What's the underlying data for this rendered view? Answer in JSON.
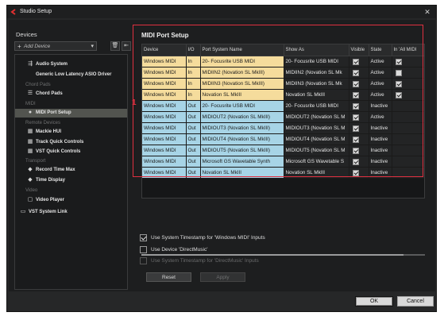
{
  "window": {
    "title": "Studio Setup",
    "close_glyph": "✕"
  },
  "left": {
    "devices_label": "Devices",
    "add_device_placeholder": "Add Device",
    "tree": [
      {
        "kind": "item",
        "label": "Audio System",
        "icon": "connector-icon",
        "glyph": "⇶",
        "indent": 1
      },
      {
        "kind": "item",
        "label": "Generic Low Latency ASIO Driver",
        "icon": "",
        "glyph": "",
        "indent": 2
      },
      {
        "kind": "category",
        "label": "Chord Pads"
      },
      {
        "kind": "item",
        "label": "Chord Pads",
        "icon": "chord-pads-icon",
        "glyph": "☰",
        "indent": 1
      },
      {
        "kind": "category",
        "label": "MIDI"
      },
      {
        "kind": "item",
        "label": "MIDI Port Setup",
        "icon": "midi-port-icon",
        "glyph": "●",
        "indent": 1,
        "selected": true
      },
      {
        "kind": "category",
        "label": "Remote Devices"
      },
      {
        "kind": "item",
        "label": "Mackie HUI",
        "icon": "remote-device-icon",
        "glyph": "▦",
        "indent": 1
      },
      {
        "kind": "item",
        "label": "Track Quick Controls",
        "icon": "remote-device-icon",
        "glyph": "▦",
        "indent": 1
      },
      {
        "kind": "item",
        "label": "VST Quick Controls",
        "icon": "remote-device-icon",
        "glyph": "▦",
        "indent": 1
      },
      {
        "kind": "category",
        "label": "Transport"
      },
      {
        "kind": "item",
        "label": "Record Time Max",
        "icon": "transport-icon",
        "glyph": "◆",
        "indent": 1
      },
      {
        "kind": "item",
        "label": "Time Display",
        "icon": "transport-icon",
        "glyph": "◆",
        "indent": 1
      },
      {
        "kind": "category",
        "label": "Video"
      },
      {
        "kind": "item",
        "label": "Video Player",
        "icon": "video-icon",
        "glyph": "▢",
        "indent": 1
      },
      {
        "kind": "item",
        "label": "VST System Link",
        "icon": "system-link-icon",
        "glyph": "▭",
        "indent": 0
      }
    ]
  },
  "main": {
    "title": "MIDI Port Setup",
    "annotation_number": "1",
    "columns": [
      "Device",
      "I/O",
      "Port System Name",
      "Show As",
      "Visible",
      "State",
      "In 'All MIDI"
    ],
    "rows": [
      {
        "device": "Windows MIDI",
        "io": "In",
        "port": "20- Focusrite USB MIDI",
        "show_as": "20- Focusrite USB MIDI",
        "visible": true,
        "state": "Active",
        "all_midi": "checked"
      },
      {
        "device": "Windows MIDI",
        "io": "In",
        "port": "MIDIIN2 (Novation SL MkIII)",
        "show_as": "MIDIIN2 (Novation SL Mk",
        "visible": true,
        "state": "Active",
        "all_midi": "blank"
      },
      {
        "device": "Windows MIDI",
        "io": "In",
        "port": "MIDIIN3 (Novation SL MkIII)",
        "show_as": "MIDIIN3 (Novation SL Mk",
        "visible": true,
        "state": "Active",
        "all_midi": "checked"
      },
      {
        "device": "Windows MIDI",
        "io": "In",
        "port": "Novation SL MkIII",
        "show_as": "Novation SL MkIII",
        "visible": true,
        "state": "Active",
        "all_midi": "checked"
      },
      {
        "device": "Windows MIDI",
        "io": "Out",
        "port": "20- Focusrite USB MIDI",
        "show_as": "20- Focusrite USB MIDI",
        "visible": true,
        "state": "Inactive",
        "all_midi": "none"
      },
      {
        "device": "Windows MIDI",
        "io": "Out",
        "port": "MIDIOUT2 (Novation SL MkIII)",
        "show_as": "MIDIOUT2 (Novation SL M",
        "visible": true,
        "state": "Active",
        "all_midi": "none"
      },
      {
        "device": "Windows MIDI",
        "io": "Out",
        "port": "MIDIOUT3 (Novation SL MkIII)",
        "show_as": "MIDIOUT3 (Novation SL M",
        "visible": true,
        "state": "Inactive",
        "all_midi": "none"
      },
      {
        "device": "Windows MIDI",
        "io": "Out",
        "port": "MIDIOUT4 (Novation SL MkIII)",
        "show_as": "MIDIOUT4 (Novation SL M",
        "visible": true,
        "state": "Inactive",
        "all_midi": "none"
      },
      {
        "device": "Windows MIDI",
        "io": "Out",
        "port": "MIDIOUT5 (Novation SL MkIII)",
        "show_as": "MIDIOUT5 (Novation SL M",
        "visible": true,
        "state": "Inactive",
        "all_midi": "none"
      },
      {
        "device": "Windows MIDI",
        "io": "Out",
        "port": "Microsoft GS Wavetable Synth",
        "show_as": "Microsoft GS Wavetable S",
        "visible": true,
        "state": "Inactive",
        "all_midi": "none"
      },
      {
        "device": "Windows MIDI",
        "io": "Out",
        "port": "Novation SL MkIII",
        "show_as": "Novation SL MkIII",
        "visible": true,
        "state": "Inactive",
        "all_midi": "none"
      }
    ],
    "options": [
      {
        "label": "Use System Timestamp for 'Windows MIDI' Inputs",
        "checked": true,
        "disabled": false
      },
      {
        "label": "Use Device 'DirectMusic'",
        "checked": false,
        "disabled": false
      },
      {
        "label": "Use System Timestamp for 'DirectMusic' Inputs",
        "checked": false,
        "disabled": true
      }
    ],
    "reset_label": "Reset",
    "apply_label": "Apply"
  },
  "footer": {
    "ok_label": "OK",
    "cancel_label": "Cancel"
  },
  "colors": {
    "in_row": "#f5dc9c",
    "out_row": "#a7d4e6",
    "highlight": "#e03040",
    "selected_item": "#52544f"
  }
}
